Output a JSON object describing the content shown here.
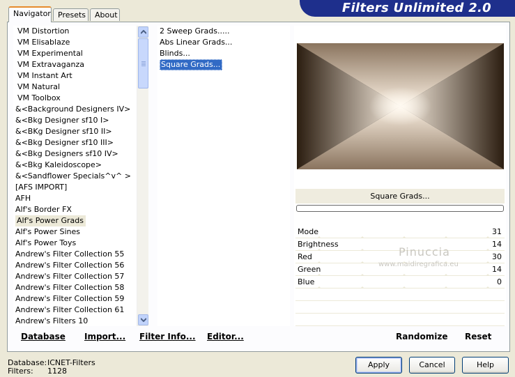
{
  "title": "Filters Unlimited 2.0",
  "tabs": [
    {
      "label": "Navigator",
      "active": true
    },
    {
      "label": "Presets",
      "active": false
    },
    {
      "label": "About",
      "active": false
    }
  ],
  "categories": [
    "VM Distortion",
    "VM Elisablaze",
    "VM Experimental",
    "VM Extravaganza",
    "VM Instant Art",
    "VM Natural",
    "VM Toolbox",
    "&<Background Designers IV>",
    "&<Bkg Designer sf10 I>",
    "&<BKg Designer sf10 II>",
    "&<Bkg Designer sf10 III>",
    "&<Bkg Designers sf10 IV>",
    "&<Bkg Kaleidoscope>",
    "&<Sandflower Specials^v^ >",
    "[AFS IMPORT]",
    "AFH",
    "Alf's Border FX",
    "Alf's Power Grads",
    "Alf's Power Sines",
    "Alf's Power Toys",
    "Andrew's Filter Collection 55",
    "Andrew's Filter Collection 56",
    "Andrew's Filter Collection 57",
    "Andrew's Filter Collection 58",
    "Andrew's Filter Collection 59",
    "Andrew's Filter Collection 61",
    "Andrew's Filters 10"
  ],
  "selected_category": "Alf's Power Grads",
  "filters": [
    "2 Sweep Grads.....",
    "Abs Linear Grads...",
    "Blinds...",
    "Square Grads..."
  ],
  "selected_filter": "Square Grads...",
  "preview_filter_name": "Square Grads...",
  "progress": 0,
  "params": [
    {
      "name": "Mode",
      "value": "31"
    },
    {
      "name": "Brightness",
      "value": "14"
    },
    {
      "name": "Red",
      "value": "30"
    },
    {
      "name": "Green",
      "value": "14"
    },
    {
      "name": "Blue",
      "value": "0"
    }
  ],
  "tab_buttons": {
    "database": "Database",
    "import": "Import...",
    "filter_info": "Filter Info...",
    "editor": "Editor...",
    "randomize": "Randomize",
    "reset": "Reset"
  },
  "footer": {
    "database_label": "Database:",
    "database_value": "ICNET-Filters",
    "filters_label": "Filters:",
    "filters_value": "1128"
  },
  "dialog_buttons": {
    "apply": "Apply",
    "cancel": "Cancel",
    "help": "Help"
  },
  "watermark": {
    "line1": "Pinuccia",
    "line2": "www.maidiregrafica.eu"
  },
  "colors": {
    "banner": "#1e2f8c",
    "selection": "#316ac5",
    "preview_dark": "#2b1d10",
    "preview_mid": "#8a745e",
    "preview_light": "#fbf0e2"
  }
}
